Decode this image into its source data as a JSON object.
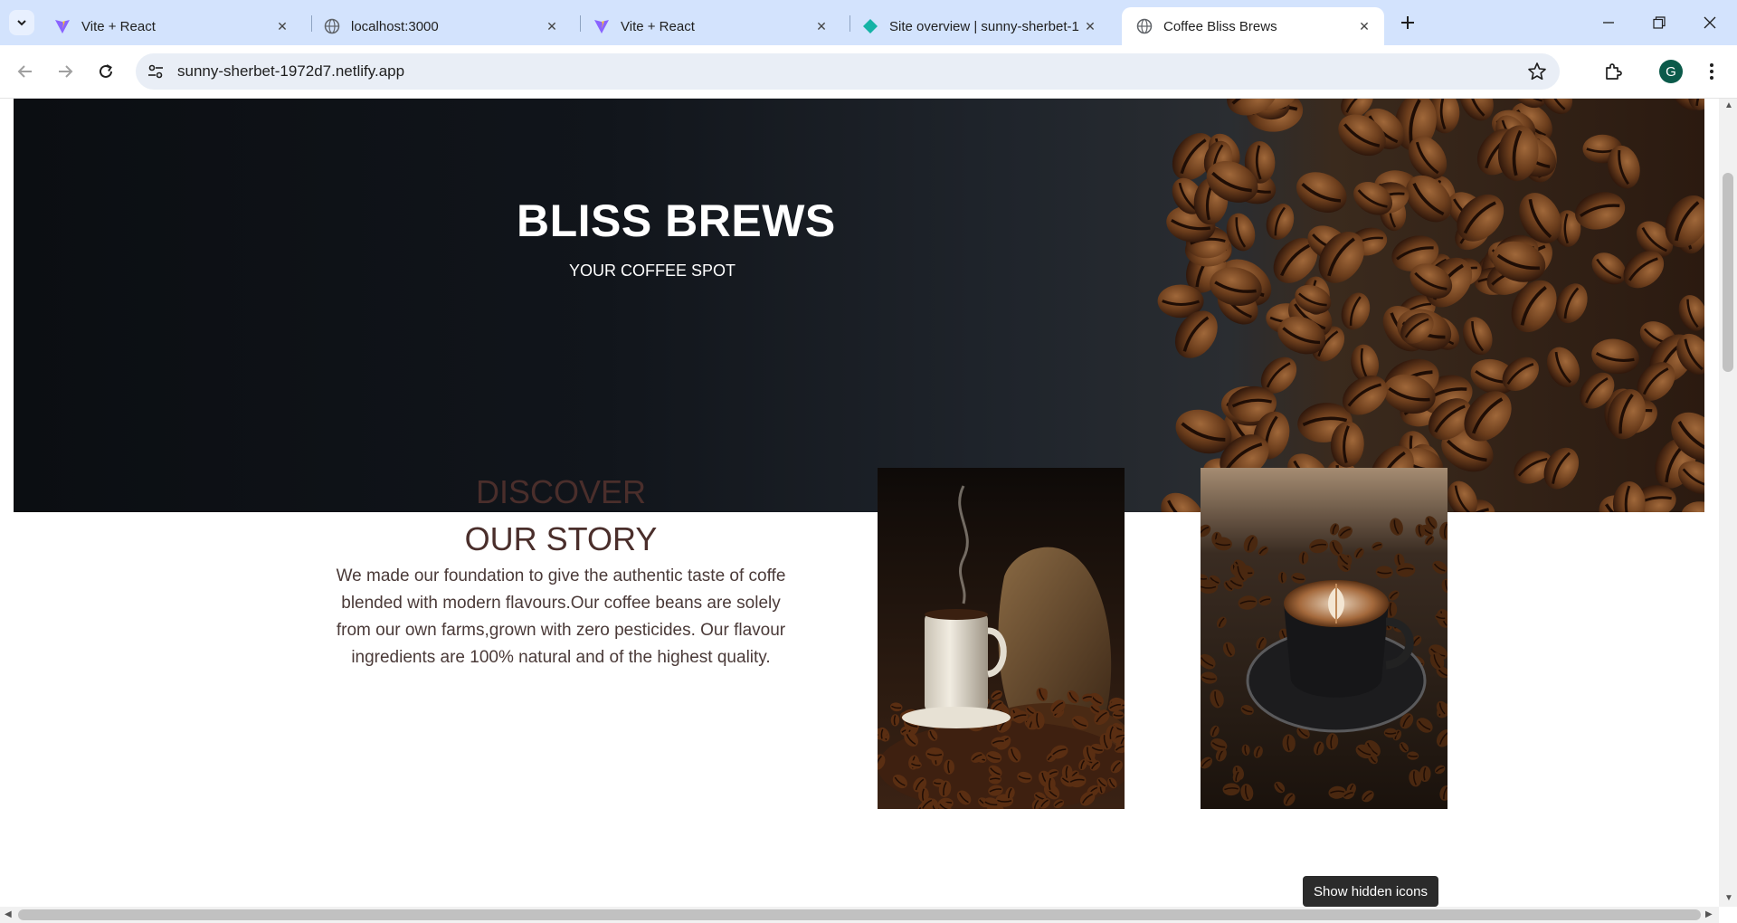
{
  "browser": {
    "tabs": [
      {
        "title": "Vite + React",
        "favicon": "vite-icon",
        "active": false
      },
      {
        "title": "localhost:3000",
        "favicon": "globe-icon",
        "active": false
      },
      {
        "title": "Vite + React",
        "favicon": "vite-icon",
        "active": false
      },
      {
        "title": "Site overview | sunny-sherbet-1",
        "favicon": "netlify-icon",
        "active": false
      },
      {
        "title": "Coffee Bliss Brews",
        "favicon": "globe-icon",
        "active": true
      }
    ],
    "url": "sunny-sherbet-1972d7.netlify.app",
    "profile_initial": "G"
  },
  "hero": {
    "title": "BLISS BREWS",
    "subtitle": "YOUR COFFEE SPOT"
  },
  "story": {
    "heading_line1": "DISCOVER",
    "heading_line2": "OUR STORY",
    "body": "We made our foundation to give the authentic taste of coffe blended with modern flavours.Our coffee beans are solely from our own farms,grown with zero pesticides. Our flavour ingredients are 100% natural and of the highest quality."
  },
  "tooltip": {
    "text": "Show hidden icons"
  },
  "colors": {
    "tabstrip": "#d3e3fd",
    "heading_brown": "#4a2e2b",
    "body_text": "#4a3a38"
  }
}
